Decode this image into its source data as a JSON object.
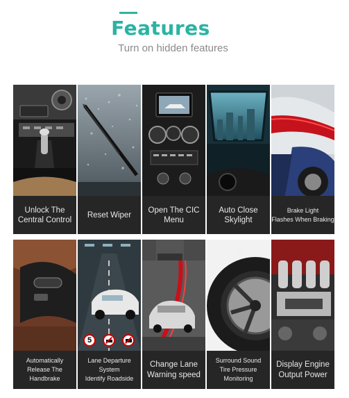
{
  "header": {
    "title": "Features",
    "subtitle": "Turn on hidden features"
  },
  "tiles": [
    {
      "label": "Unlock The\nCentral Control",
      "icon": "central-console-photo"
    },
    {
      "label": "Reset Wiper",
      "icon": "wiper-photo"
    },
    {
      "label": "Open The CIC\nMenu",
      "icon": "cic-screen-photo"
    },
    {
      "label": "Auto Close\nSkylight",
      "icon": "sunroof-photo"
    },
    {
      "label": "Brake Light\nFlashes When Braking",
      "icon": "brake-light-photo"
    },
    {
      "label": "Automatically\nRelease The Handbrake",
      "icon": "handbrake-photo"
    },
    {
      "label": "Lane Departure\nSystem\nIdentify Roadside",
      "icon": "lane-departure-photo"
    },
    {
      "label": "Change Lane\nWarning speed",
      "icon": "lane-change-photo"
    },
    {
      "label": "Surround Sound\nTire Pressure\nMonitoring",
      "icon": "tire-photo"
    },
    {
      "label": "Display Engine\nOutput Power",
      "icon": "engine-photo"
    }
  ],
  "signs": [
    "5"
  ],
  "colors": {
    "accent": "#2bb3a3",
    "caption_bg": "#262626",
    "caption_text": "#e8e8e8"
  }
}
